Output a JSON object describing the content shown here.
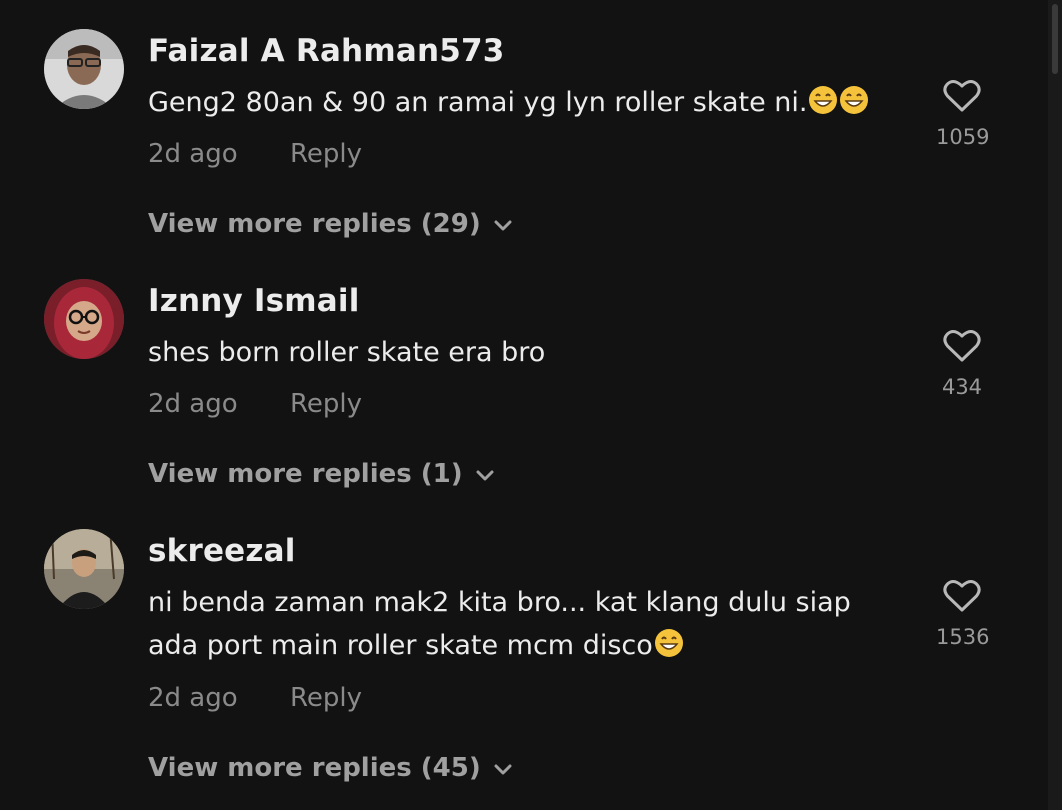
{
  "comments": [
    {
      "username": "Faizal A Rahman573",
      "text": "Geng2 80an & 90 an ramai yg lyn roller skate ni.",
      "emojis": [
        "grinning-face-emoji",
        "grinning-face-emoji"
      ],
      "time": "2d ago",
      "reply_label": "Reply",
      "likes": "1059",
      "view_more": "View more replies (29)"
    },
    {
      "username": "Iznny Ismail",
      "text": "shes born roller skate era bro",
      "emojis": [],
      "time": "2d ago",
      "reply_label": "Reply",
      "likes": "434",
      "view_more": "View more replies (1)"
    },
    {
      "username": "skreezal",
      "text": "ni benda zaman mak2 kita bro... kat klang dulu siap ada port main roller skate mcm disco",
      "emojis": [
        "grinning-face-emoji"
      ],
      "time": "2d ago",
      "reply_label": "Reply",
      "likes": "1536",
      "view_more": "View more replies (45)"
    }
  ],
  "colors": {
    "background": "#121212",
    "primary_text": "#ececec",
    "secondary_text": "#8a8a8a",
    "emoji_yellow": "#f5c33b"
  }
}
